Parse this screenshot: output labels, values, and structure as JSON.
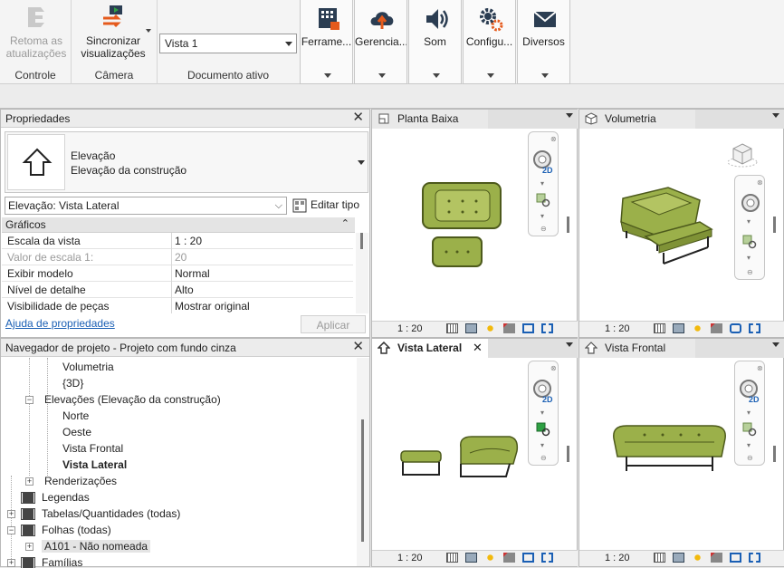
{
  "ribbon": {
    "controle": {
      "button": "Retoma as atualizações",
      "group": "Controle"
    },
    "camera": {
      "button": "Sincronizar visualizações",
      "group": "Câmera"
    },
    "documento": {
      "combo_value": "Vista 1",
      "group": "Documento ativo"
    },
    "tools": [
      {
        "label": "Ferrame...",
        "icon": "building-tools-icon"
      },
      {
        "label": "Gerencia...",
        "icon": "cloud-upload-icon"
      },
      {
        "label": "Som",
        "icon": "speaker-icon"
      },
      {
        "label": "Configu...",
        "icon": "gears-icon"
      },
      {
        "label": "Diversos",
        "icon": "envelope-icon"
      }
    ]
  },
  "properties": {
    "title": "Propriedades",
    "type_line1": "Elevação",
    "type_line2": "Elevação da construção",
    "instance_select": "Elevação: Vista Lateral",
    "edit_type": "Editar tipo",
    "section": "Gráficos",
    "rows": [
      {
        "key": "Escala da vista",
        "value": "1 : 20",
        "disabled": false
      },
      {
        "key": "Valor de escala    1:",
        "value": "20",
        "disabled": true
      },
      {
        "key": "Exibir modelo",
        "value": "Normal",
        "disabled": false
      },
      {
        "key": "Nível de detalhe",
        "value": "Alto",
        "disabled": false
      },
      {
        "key": "Visibilidade de peças",
        "value": "Mostrar original",
        "disabled": false
      }
    ],
    "help_link": "Ajuda de propriedades",
    "apply": "Aplicar"
  },
  "navigator": {
    "title": "Navegador de projeto - Projeto com fundo cinza",
    "items": [
      {
        "label": "Volumetria",
        "level": 3,
        "bold": false,
        "toggle": ""
      },
      {
        "label": "{3D}",
        "level": 3,
        "bold": false,
        "toggle": ""
      },
      {
        "label": "Elevações (Elevação da construção)",
        "level": 2,
        "bold": false,
        "toggle": "−"
      },
      {
        "label": "Norte",
        "level": 3,
        "bold": false,
        "toggle": ""
      },
      {
        "label": "Oeste",
        "level": 3,
        "bold": false,
        "toggle": ""
      },
      {
        "label": "Vista Frontal",
        "level": 3,
        "bold": false,
        "toggle": ""
      },
      {
        "label": "Vista Lateral",
        "level": 3,
        "bold": true,
        "toggle": ""
      },
      {
        "label": "Renderizações",
        "level": 2,
        "bold": false,
        "toggle": "+"
      },
      {
        "label": "Legendas",
        "level": 1,
        "bold": false,
        "toggle": ""
      },
      {
        "label": "Tabelas/Quantidades (todas)",
        "level": 1,
        "bold": false,
        "toggle": "+"
      },
      {
        "label": "Folhas (todas)",
        "level": 1,
        "bold": false,
        "toggle": "−"
      },
      {
        "label": "A101 - Não nomeada",
        "level": 2,
        "bold": false,
        "toggle": "+"
      },
      {
        "label": "Famílias",
        "level": 1,
        "bold": false,
        "toggle": "+"
      }
    ]
  },
  "views": [
    {
      "name": "Planta Baixa",
      "scale": "1 : 20",
      "active": false,
      "nav_label": "2D"
    },
    {
      "name": "Volumetria",
      "scale": "1 : 20",
      "active": false,
      "nav_label": ""
    },
    {
      "name": "Vista Lateral",
      "scale": "1 : 20",
      "active": true,
      "nav_label": "2D"
    },
    {
      "name": "Vista Frontal",
      "scale": "1 : 20",
      "active": false,
      "nav_label": "2D"
    }
  ],
  "colors": {
    "sofa": "#9bb04a",
    "sofa_dark": "#4d5a1c",
    "accent": "#1a5fb4",
    "link": "#1a5fb4"
  }
}
